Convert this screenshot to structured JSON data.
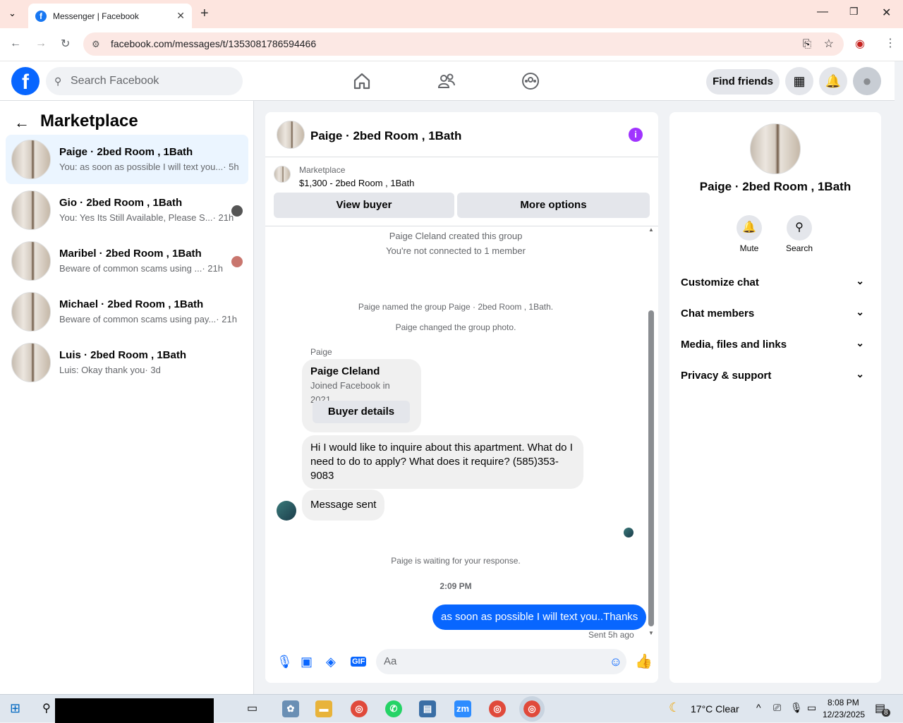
{
  "browser": {
    "tab_title": "Messenger | Facebook",
    "url": "facebook.com/messages/t/1353081786594466"
  },
  "header": {
    "search_placeholder": "Search Facebook",
    "find_friends": "Find friends"
  },
  "sidebar": {
    "title": "Marketplace",
    "conversations": [
      {
        "title": "Paige · 2bed Room , 1Bath",
        "preview": "You: as soon as possible I will text you...",
        "time": "· 5h"
      },
      {
        "title": "Gio · 2bed Room , 1Bath",
        "preview": "You: Yes Its Still Available, Please S...",
        "time": "· 21h"
      },
      {
        "title": "Maribel · 2bed Room , 1Bath",
        "preview": "Beware of common scams using ...",
        "time": "· 21h"
      },
      {
        "title": "Michael · 2bed Room , 1Bath",
        "preview": "Beware of common scams using pay...",
        "time": "· 21h"
      },
      {
        "title": "Luis · 2bed Room , 1Bath",
        "preview": "Luis: Okay thank you",
        "time": "· 3d"
      }
    ]
  },
  "chat": {
    "title": "Paige · 2bed Room , 1Bath",
    "marketplace_label": "Marketplace",
    "listing": "$1,300 - 2bed Room , 1Bath",
    "view_buyer": "View buyer",
    "more_options": "More options",
    "system": {
      "created": "Paige Cleland created this group",
      "not_connected": "You're not connected to 1 member",
      "named": "Paige named the group Paige · 2bed Room , 1Bath.",
      "photo": "Paige changed the group photo.",
      "waiting": "Paige is waiting for your response.",
      "timestamp": "2:09 PM"
    },
    "sender": "Paige",
    "card": {
      "name": "Paige Cleland",
      "joined": "Joined Facebook in 2021",
      "button": "Buyer details"
    },
    "incoming_message": "Hi I would like to inquire about this apartment. What do I need to do to apply? What does it require? (585)353-9083",
    "message_sent": "Message sent",
    "outgoing_message": "as soon as possible I will text you..Thanks",
    "sent_status": "Sent 5h ago",
    "input_placeholder": "Aa"
  },
  "details": {
    "name": "Paige · 2bed Room , 1Bath",
    "mute": "Mute",
    "search": "Search",
    "sections": [
      "Customize chat",
      "Chat members",
      "Media, files and links",
      "Privacy & support"
    ]
  },
  "taskbar": {
    "weather": "17°C  Clear",
    "time": "8:08 PM",
    "date": "12/23/2025",
    "notifications": "8"
  },
  "colors": {
    "accent": "#0866ff",
    "info": "#a033ff"
  }
}
